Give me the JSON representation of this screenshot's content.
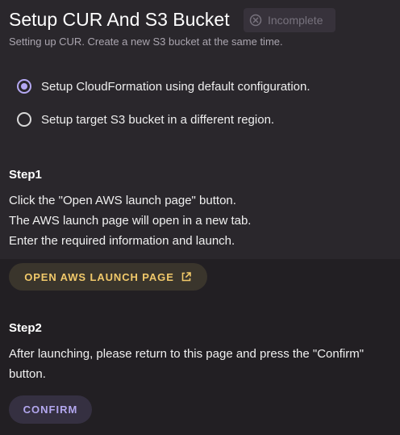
{
  "page": {
    "title": "Setup CUR And S3 Bucket",
    "subtitle": "Setting up CUR. Create a new S3 bucket at the same time.",
    "status": {
      "label": "Incomplete",
      "icon": "close-circle-icon"
    }
  },
  "options": [
    {
      "label": "Setup CloudFormation using default configuration.",
      "selected": true
    },
    {
      "label": "Setup target S3 bucket in a different region.",
      "selected": false
    }
  ],
  "step1": {
    "heading": "Step1",
    "lines": [
      "Click the \"Open AWS launch page\" button.",
      "The AWS launch page will open in a new tab.",
      "Enter the required information and launch."
    ],
    "button": {
      "label": "OPEN AWS LAUNCH PAGE",
      "icon": "external-link-icon"
    }
  },
  "step2": {
    "heading": "Step2",
    "lines": [
      "After launching, please return to this page and press the \"Confirm\"",
      "button."
    ],
    "button": {
      "label": "CONFIRM"
    }
  },
  "colors": {
    "page_background": "#242127",
    "accent_purple": "#b4a8f2",
    "accent_yellow": "#f1c96a",
    "muted_text": "#aaa5af"
  }
}
